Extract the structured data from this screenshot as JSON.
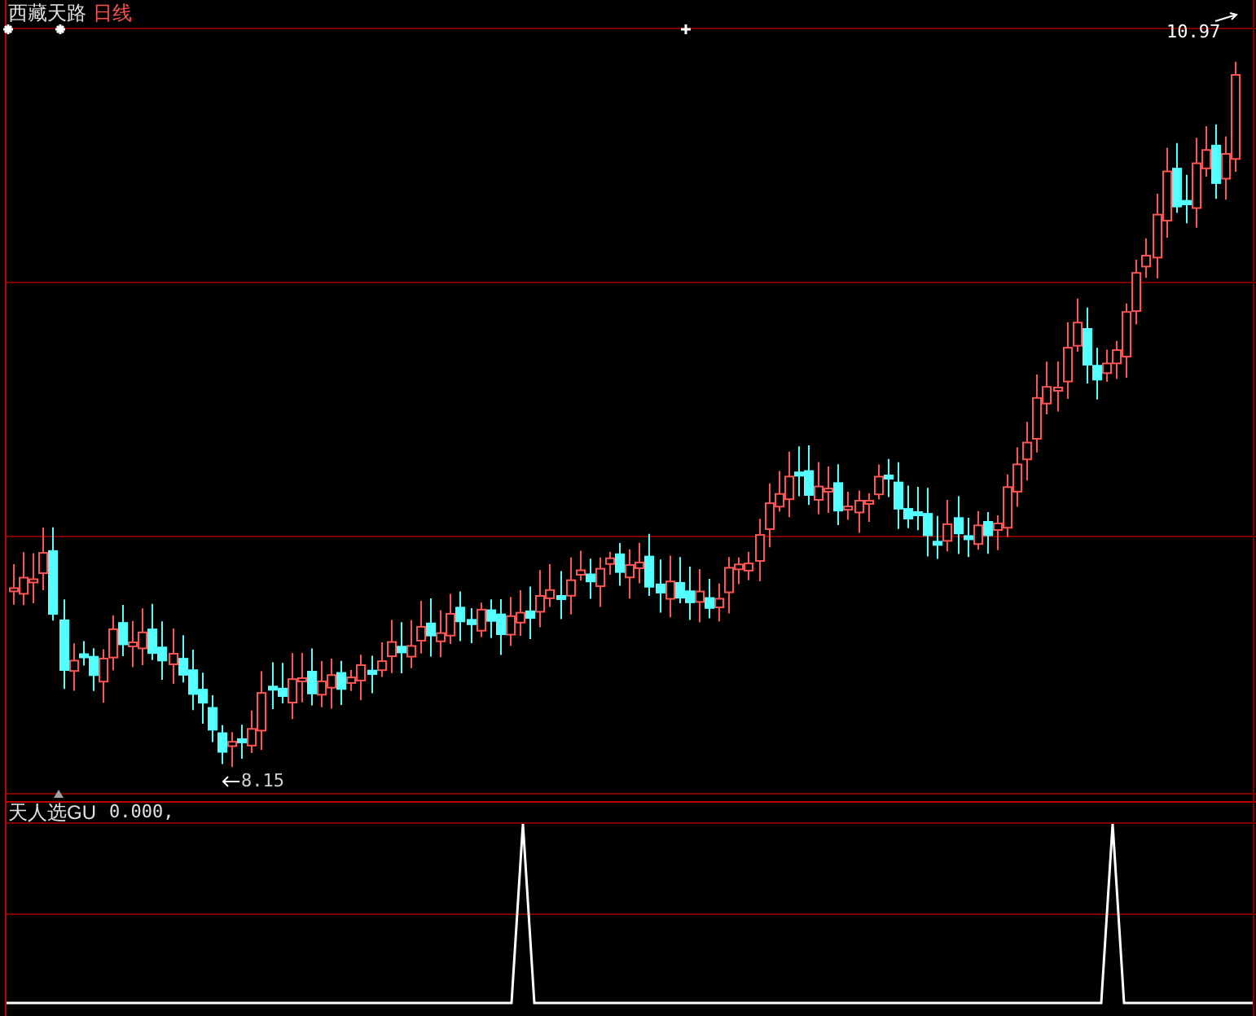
{
  "header": {
    "title": "西藏天路",
    "period": "日线"
  },
  "price_chart": {
    "high_label": "10.97",
    "low_label": "8.15"
  },
  "indicator": {
    "name": "天人选GU",
    "value": "0.000,"
  }
}
